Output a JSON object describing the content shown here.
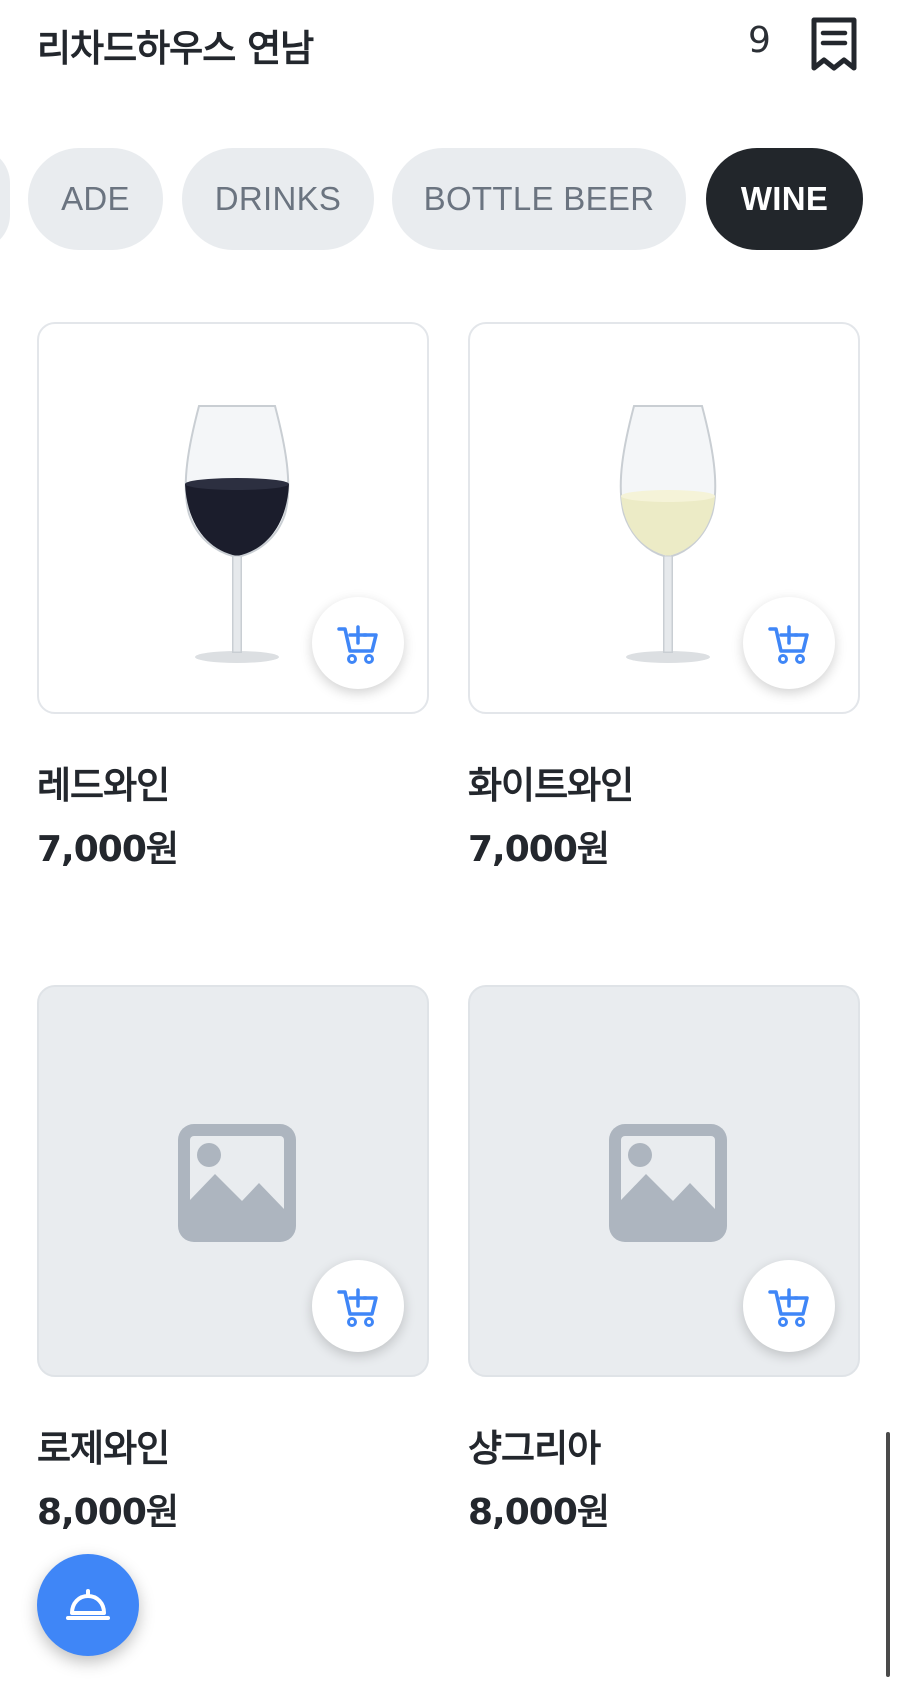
{
  "header": {
    "store_name": "리차드하우스 연남",
    "table_number": "9",
    "receipt_icon": "receipt-icon"
  },
  "tabs": [
    {
      "label": "",
      "active": false
    },
    {
      "label": "ADE",
      "active": false
    },
    {
      "label": "DRINKS",
      "active": false
    },
    {
      "label": "BOTTLE BEER",
      "active": false
    },
    {
      "label": "WINE",
      "active": true
    }
  ],
  "items": [
    {
      "name": "레드와인",
      "price": "7,000원",
      "image": "red-wine-glass"
    },
    {
      "name": "화이트와인",
      "price": "7,000원",
      "image": "white-wine-glass"
    },
    {
      "name": "로제와인",
      "price": "8,000원",
      "image": "image-placeholder-icon"
    },
    {
      "name": "샹그리아",
      "price": "8,000원",
      "image": "image-placeholder-icon"
    }
  ],
  "colors": {
    "accent": "#3f86f7",
    "tab_active_bg": "#22262b",
    "tab_bg": "#e9ecef",
    "placeholder_bg": "#e9ecef",
    "placeholder_icon": "#adb5bf"
  },
  "fab_icon": "service-bell-icon"
}
